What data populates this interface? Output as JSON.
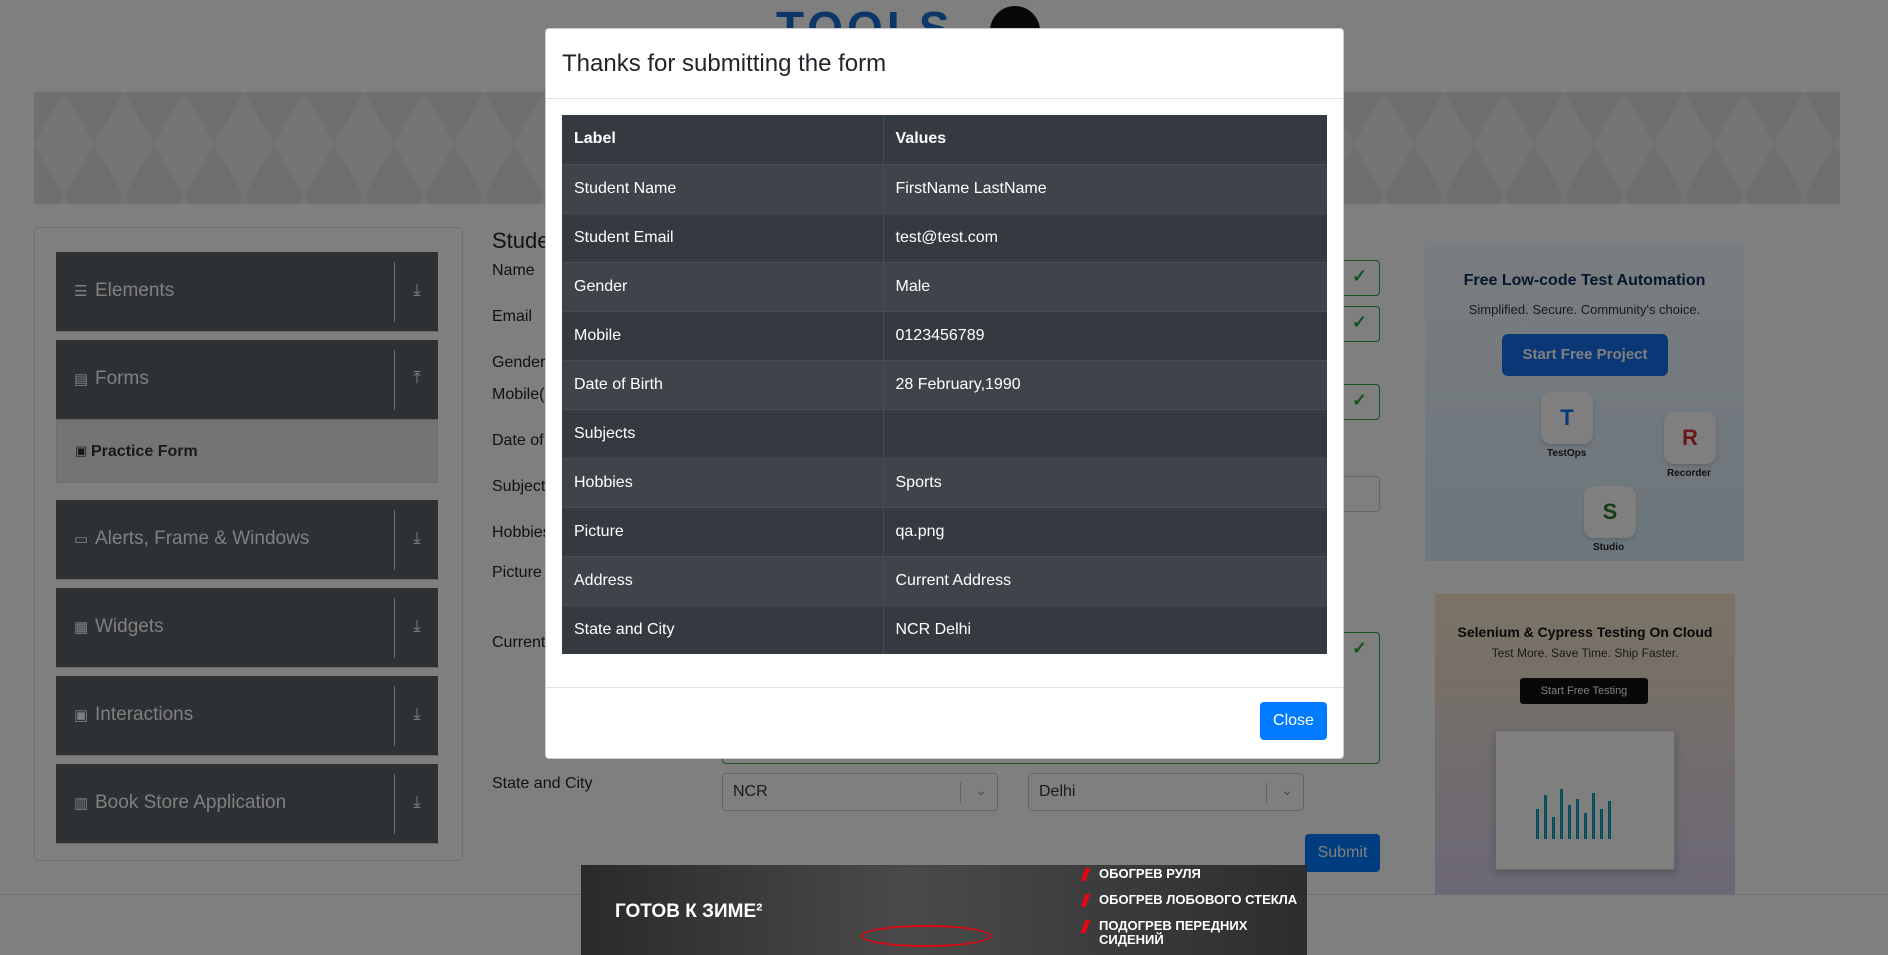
{
  "header": {
    "logo_text": "TOOLS"
  },
  "sidebar": {
    "groups": [
      {
        "label": "Elements",
        "icon": "hamburger-icon",
        "toggle": "download-icon"
      },
      {
        "label": "Forms",
        "icon": "document-icon",
        "toggle": "upload-icon"
      },
      {
        "label": "Alerts, Frame & Windows",
        "icon": "window-icon",
        "toggle": "download-icon"
      },
      {
        "label": "Widgets",
        "icon": "grid-icon",
        "toggle": "download-icon"
      },
      {
        "label": "Interactions",
        "icon": "interaction-icon",
        "toggle": "download-icon"
      },
      {
        "label": "Book Store Application",
        "icon": "books-icon",
        "toggle": "download-icon"
      }
    ],
    "active_item": {
      "label": "Practice Form"
    }
  },
  "form": {
    "title": "Stude",
    "labels": {
      "name": "Name",
      "email": "Email",
      "gender": "Gender",
      "mobile": "Mobile(",
      "dob": "Date of",
      "subjects": "Subject",
      "hobbies": "Hobbies",
      "picture": "Picture",
      "current": "Current",
      "state_city": "State and City"
    },
    "state_value": "NCR",
    "city_value": "Delhi",
    "submit_label": "Submit"
  },
  "modal": {
    "title": "Thanks for submitting the form",
    "table": {
      "headers": [
        "Label",
        "Values"
      ],
      "rows": [
        [
          "Student Name",
          "FirstName LastName"
        ],
        [
          "Student Email",
          "test@test.com"
        ],
        [
          "Gender",
          "Male"
        ],
        [
          "Mobile",
          "0123456789"
        ],
        [
          "Date of Birth",
          "28 February,1990"
        ],
        [
          "Subjects",
          ""
        ],
        [
          "Hobbies",
          "Sports"
        ],
        [
          "Picture",
          "qa.png"
        ],
        [
          "Address",
          "Current Address"
        ],
        [
          "State and City",
          "NCR Delhi"
        ]
      ]
    },
    "close_label": "Close"
  },
  "ads": {
    "ad1": {
      "title": "Free Low-code Test Automation",
      "subtitle": "Simplified. Secure. Community's choice.",
      "button": "Start Free Project",
      "tiles": [
        "TestOps",
        "Recorder",
        "Studio"
      ]
    },
    "ad2": {
      "title": "Selenium & Cypress Testing On Cloud",
      "subtitle": "Test More. Save Time. Ship Faster.",
      "button": "Start Free Testing"
    },
    "bottom": {
      "title": "ГОТОВ К ЗИМЕ²",
      "items": [
        "ОБОГРЕВ РУЛЯ",
        "ОБОГРЕВ ЛОБОВОГО СТЕКЛА",
        "ПОДОГРЕВ ПЕРЕДНИХ СИДЕНИЙ"
      ]
    }
  },
  "colors": {
    "accent": "#007bff",
    "valid": "#28a745",
    "table_dark": "#343a40",
    "sidebar_group": "#5a6268"
  }
}
